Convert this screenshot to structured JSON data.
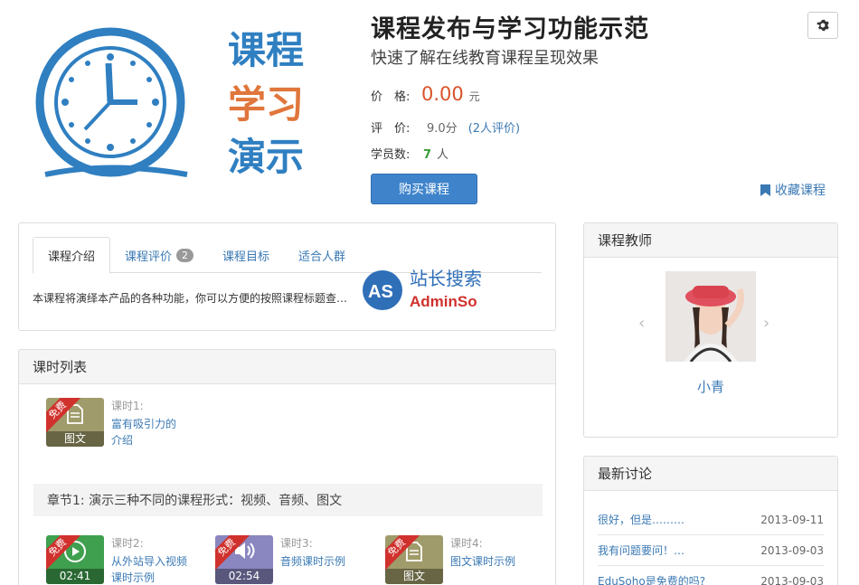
{
  "cover": {
    "text_lines": [
      "课程",
      "学习",
      "演示"
    ],
    "line_colors": [
      "#2f7fc1",
      "#e0763c",
      "#2f7fc1"
    ]
  },
  "header": {
    "title": "课程发布与学习功能示范",
    "subtitle": "快速了解在线教育课程呈现效果",
    "gear_icon": "gear-icon"
  },
  "meta": {
    "price_label": "价　格:",
    "price_value": "0.00",
    "price_unit": "元",
    "rating_label": "评　价:",
    "rating_value": "9.0分",
    "rating_count": "(2人评价)",
    "students_label": "学员数:",
    "students_value": "7",
    "students_unit": "人"
  },
  "actions": {
    "buy_label": "购买课程",
    "favorite_label": "收藏课程",
    "favorite_icon": "bookmark-icon"
  },
  "intro": {
    "tabs": [
      {
        "label": "课程介绍",
        "active": true
      },
      {
        "label": "课程评价",
        "badge": "2"
      },
      {
        "label": "课程目标"
      },
      {
        "label": "适合人群"
      }
    ],
    "text": "本课程将演绎本产品的各种功能，你可以方便的按照课程标题查…",
    "watermark": {
      "line1": "站长搜索",
      "line2": "AdminSo",
      "logo": "AS"
    }
  },
  "lessons": {
    "heading": "课时列表",
    "free_badge": "免费",
    "items": [
      {
        "number": "课时1:",
        "title": "富有吸引力的介绍",
        "type": "图文",
        "icon": "document-icon",
        "color": "#a09b6a"
      },
      {
        "number": "课时2:",
        "title": "从外站导入视频课时示例",
        "type": "02:41",
        "icon": "play-icon",
        "color": "#3fa04f"
      },
      {
        "number": "课时3:",
        "title": "音频课时示例",
        "type": "02:54",
        "icon": "speaker-icon",
        "color": "#8a86c0"
      },
      {
        "number": "课时4:",
        "title": "图文课时示例",
        "type": "图文",
        "icon": "document-icon",
        "color": "#a09b6a"
      }
    ],
    "chapter": "章节1: 演示三种不同的课程形式：视频、音频、图文"
  },
  "teacher": {
    "heading": "课程教师",
    "name": "小青",
    "prev": "‹",
    "next": "›"
  },
  "discussion": {
    "heading": "最新讨论",
    "items": [
      {
        "title": "很好，但是………",
        "date": "2013-09-11"
      },
      {
        "title": "我有问题要问！…",
        "date": "2013-09-03"
      },
      {
        "title": "EduSoho是免费的吗?",
        "date": "2013-09-03"
      }
    ]
  }
}
